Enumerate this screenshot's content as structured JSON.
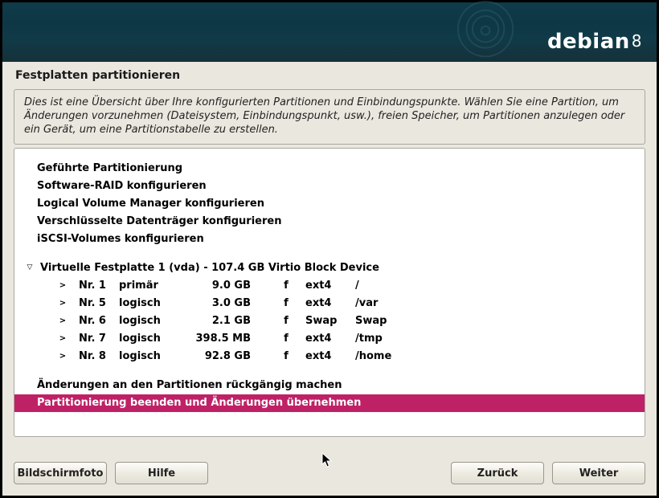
{
  "brand": {
    "name": "debian",
    "version": "8"
  },
  "page_title": "Festplatten partitionieren",
  "description": "Dies ist eine Übersicht über Ihre konfigurierten Partitionen und Einbindungspunkte. Wählen Sie eine Partition, um Änderungen vorzunehmen (Dateisystem, Einbindungspunkt, usw.), freien Speicher, um Partitionen anzulegen oder ein Gerät, um eine Partitionstabelle zu erstellen.",
  "menu": {
    "guided": "Geführte Partitionierung",
    "raid": "Software-RAID konfigurieren",
    "lvm": "Logical Volume Manager konfigurieren",
    "crypt": "Verschlüsselte Datenträger konfigurieren",
    "iscsi": "iSCSI-Volumes konfigurieren"
  },
  "disk": {
    "header": "Virtuelle Festplatte 1 (vda) - 107.4 GB Virtio Block Device",
    "partitions": [
      {
        "num": "Nr. 1",
        "ptype": "primär",
        "size": "9.0 GB",
        "fflag": "f",
        "fs": "ext4",
        "mount": "/"
      },
      {
        "num": "Nr. 5",
        "ptype": "logisch",
        "size": "3.0 GB",
        "fflag": "f",
        "fs": "ext4",
        "mount": "/var"
      },
      {
        "num": "Nr. 6",
        "ptype": "logisch",
        "size": "2.1 GB",
        "fflag": "f",
        "fs": "Swap",
        "mount": "Swap"
      },
      {
        "num": "Nr. 7",
        "ptype": "logisch",
        "size": "398.5 MB",
        "fflag": "f",
        "fs": "ext4",
        "mount": "/tmp"
      },
      {
        "num": "Nr. 8",
        "ptype": "logisch",
        "size": "92.8 GB",
        "fflag": "f",
        "fs": "ext4",
        "mount": "/home"
      }
    ]
  },
  "actions": {
    "undo": "Änderungen an den Partitionen rückgängig machen",
    "finish": "Partitionierung beenden und Änderungen übernehmen"
  },
  "buttons": {
    "screenshot": "Bildschirmfoto",
    "help": "Hilfe",
    "back": "Zurück",
    "continue": "Weiter"
  }
}
